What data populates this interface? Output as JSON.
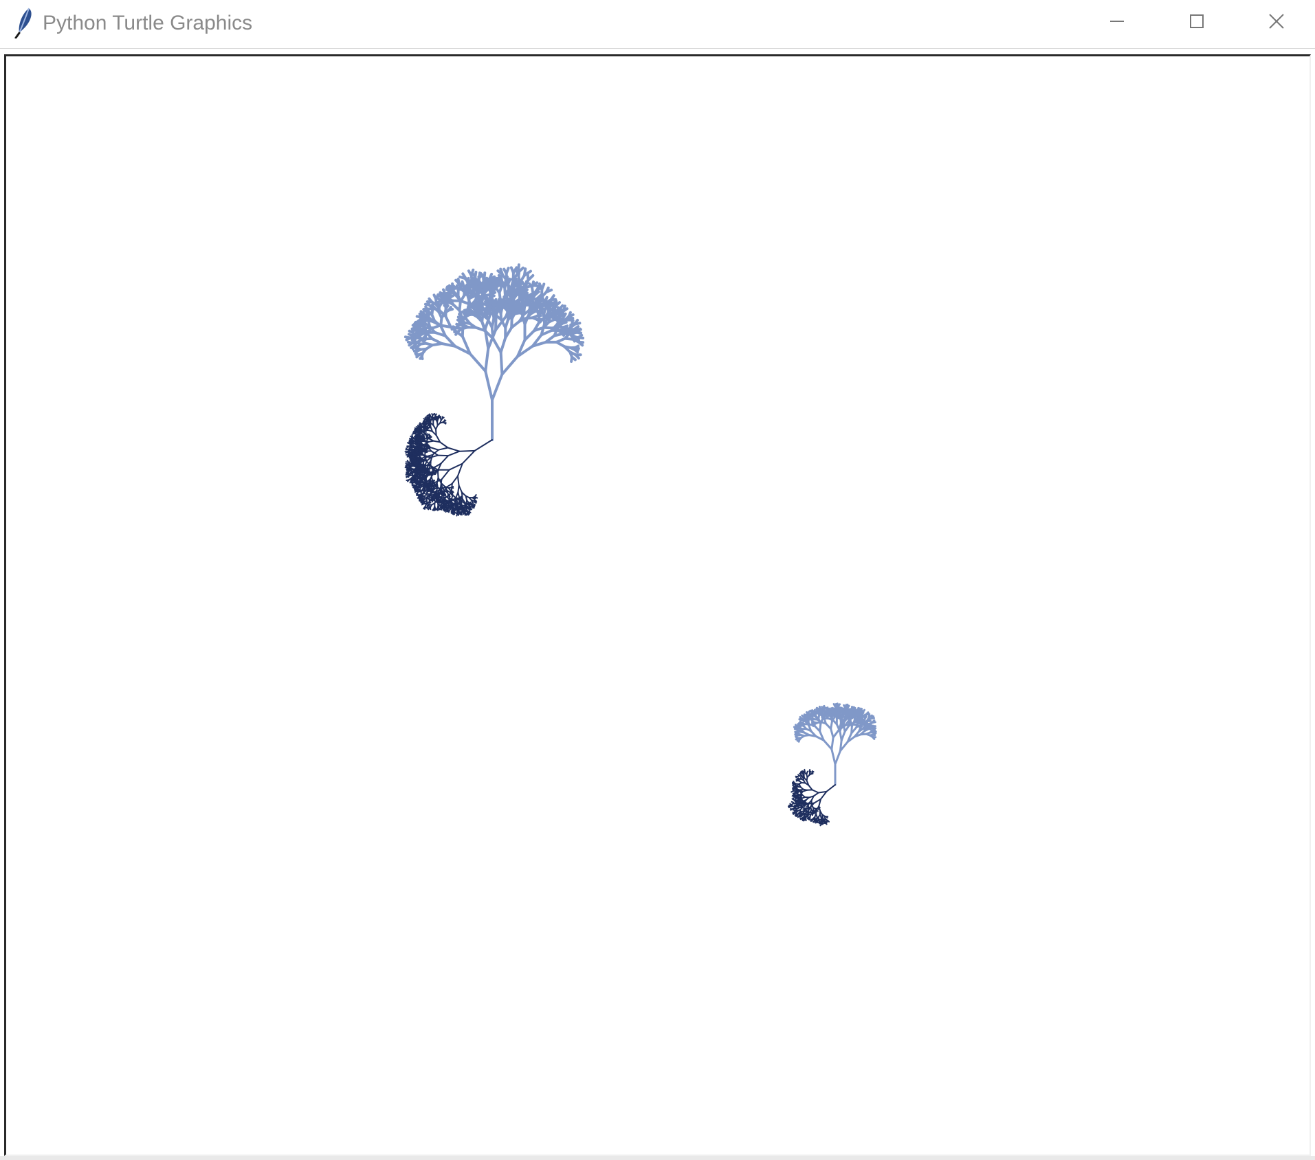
{
  "window": {
    "title": "Python Turtle Graphics",
    "icon": "feather-icon",
    "controls": {
      "minimize_icon": "minimize-icon",
      "maximize_icon": "maximize-icon",
      "close_icon": "close-icon"
    }
  },
  "canvas": {
    "background": "#ffffff",
    "drawings": [
      {
        "name": "large fractal tree",
        "trunk_color": "#8098c8",
        "root_color": "#1f2f5f"
      },
      {
        "name": "small fractal tree",
        "trunk_color": "#8098c8",
        "root_color": "#1f2f5f"
      }
    ]
  }
}
